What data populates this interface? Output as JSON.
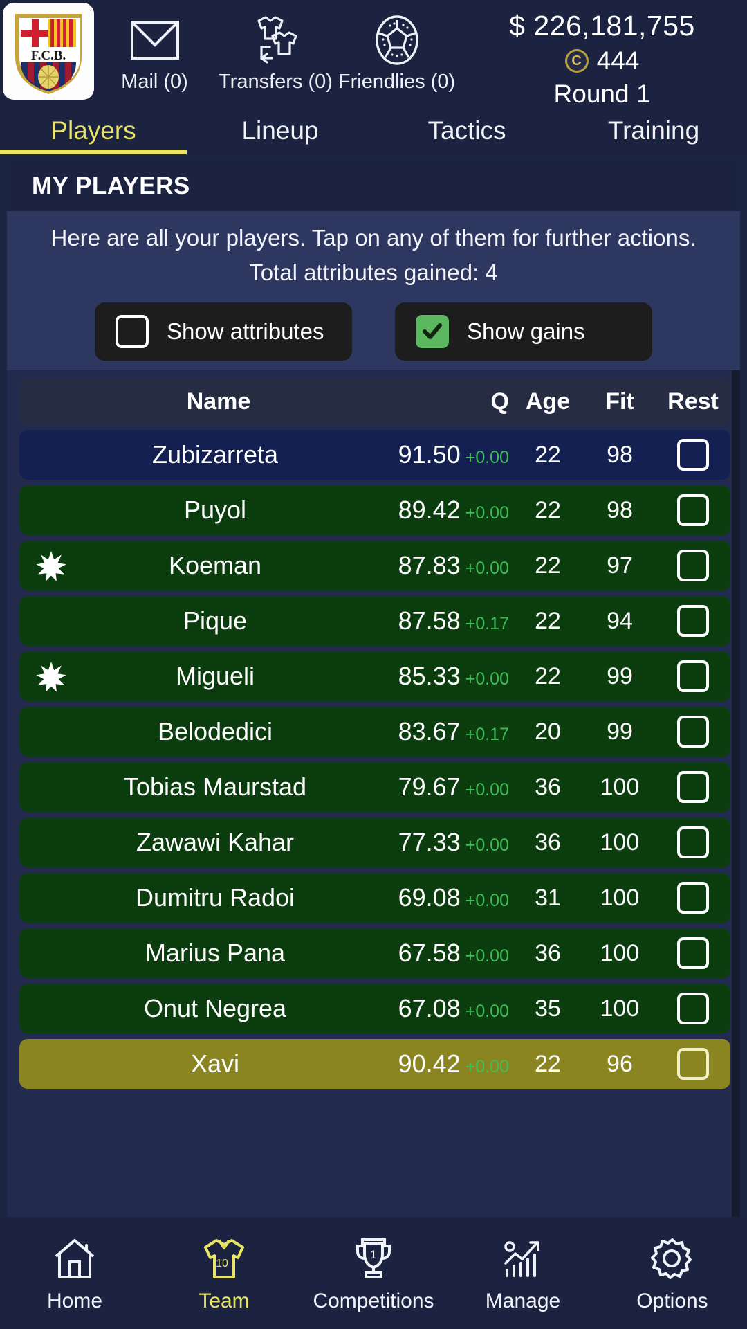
{
  "header": {
    "crest_icon": "fc-barcelona-crest",
    "crest_text": "F. C. B.",
    "items": [
      {
        "icon": "mail-icon",
        "label": "Mail (0)"
      },
      {
        "icon": "transfers-icon",
        "label": "Transfers (0)"
      },
      {
        "icon": "football-icon",
        "label": "Friendlies (0)"
      }
    ],
    "money": "$ 226,181,755",
    "coin_icon": "coin-icon",
    "coins": "444",
    "round": "Round 1"
  },
  "tabs": [
    {
      "label": "Players",
      "active": true
    },
    {
      "label": "Lineup",
      "active": false
    },
    {
      "label": "Tactics",
      "active": false
    },
    {
      "label": "Training",
      "active": false
    }
  ],
  "panel": {
    "title": "MY PLAYERS",
    "description": "Here are all your players. Tap on any of them for further actions.",
    "attributes_gained": "Total attributes gained: 4",
    "toggles": [
      {
        "label": "Show attributes",
        "checked": false,
        "icon": "checkbox-unchecked-icon"
      },
      {
        "label": "Show gains",
        "checked": true,
        "icon": "checkbox-checked-icon"
      }
    ]
  },
  "table": {
    "columns": [
      "Name",
      "Q",
      "Age",
      "Fit",
      "Rest"
    ],
    "rows": [
      {
        "star": false,
        "name": "Zubizarreta",
        "q": "91.50",
        "gain": "+0.00",
        "age": "22",
        "fit": "98",
        "rest": false,
        "style": "navy"
      },
      {
        "star": false,
        "name": "Puyol",
        "q": "89.42",
        "gain": "+0.00",
        "age": "22",
        "fit": "98",
        "rest": false,
        "style": "green"
      },
      {
        "star": true,
        "name": "Koeman",
        "q": "87.83",
        "gain": "+0.00",
        "age": "22",
        "fit": "97",
        "rest": false,
        "style": "green"
      },
      {
        "star": false,
        "name": "Pique",
        "q": "87.58",
        "gain": "+0.17",
        "age": "22",
        "fit": "94",
        "rest": false,
        "style": "green"
      },
      {
        "star": true,
        "name": "Migueli",
        "q": "85.33",
        "gain": "+0.00",
        "age": "22",
        "fit": "99",
        "rest": false,
        "style": "green"
      },
      {
        "star": false,
        "name": "Belodedici",
        "q": "83.67",
        "gain": "+0.17",
        "age": "20",
        "fit": "99",
        "rest": false,
        "style": "green"
      },
      {
        "star": false,
        "name": "Tobias Maurstad",
        "q": "79.67",
        "gain": "+0.00",
        "age": "36",
        "fit": "100",
        "rest": false,
        "style": "green"
      },
      {
        "star": false,
        "name": "Zawawi Kahar",
        "q": "77.33",
        "gain": "+0.00",
        "age": "36",
        "fit": "100",
        "rest": false,
        "style": "green"
      },
      {
        "star": false,
        "name": "Dumitru Radoi",
        "q": "69.08",
        "gain": "+0.00",
        "age": "31",
        "fit": "100",
        "rest": false,
        "style": "green"
      },
      {
        "star": false,
        "name": "Marius Pana",
        "q": "67.58",
        "gain": "+0.00",
        "age": "36",
        "fit": "100",
        "rest": false,
        "style": "green"
      },
      {
        "star": false,
        "name": "Onut Negrea",
        "q": "67.08",
        "gain": "+0.00",
        "age": "35",
        "fit": "100",
        "rest": false,
        "style": "green"
      },
      {
        "star": false,
        "name": "Xavi",
        "q": "90.42",
        "gain": "+0.00",
        "age": "22",
        "fit": "96",
        "rest": false,
        "style": "olive"
      }
    ]
  },
  "bottom_nav": [
    {
      "icon": "home-icon",
      "label": "Home",
      "active": false
    },
    {
      "icon": "jersey-icon",
      "label": "Team",
      "active": true
    },
    {
      "icon": "trophy-icon",
      "label": "Competitions",
      "active": false
    },
    {
      "icon": "chart-arrow-icon",
      "label": "Manage",
      "active": false
    },
    {
      "icon": "gear-icon",
      "label": "Options",
      "active": false
    }
  ],
  "colors": {
    "background": "#1b2441",
    "accent_yellow": "#e8e465",
    "row_navy": "#141f52",
    "row_green": "#0c3d0f",
    "row_olive": "#8a8421",
    "gain_green": "#3fbe57",
    "checkbox_green": "#5cb85f"
  }
}
